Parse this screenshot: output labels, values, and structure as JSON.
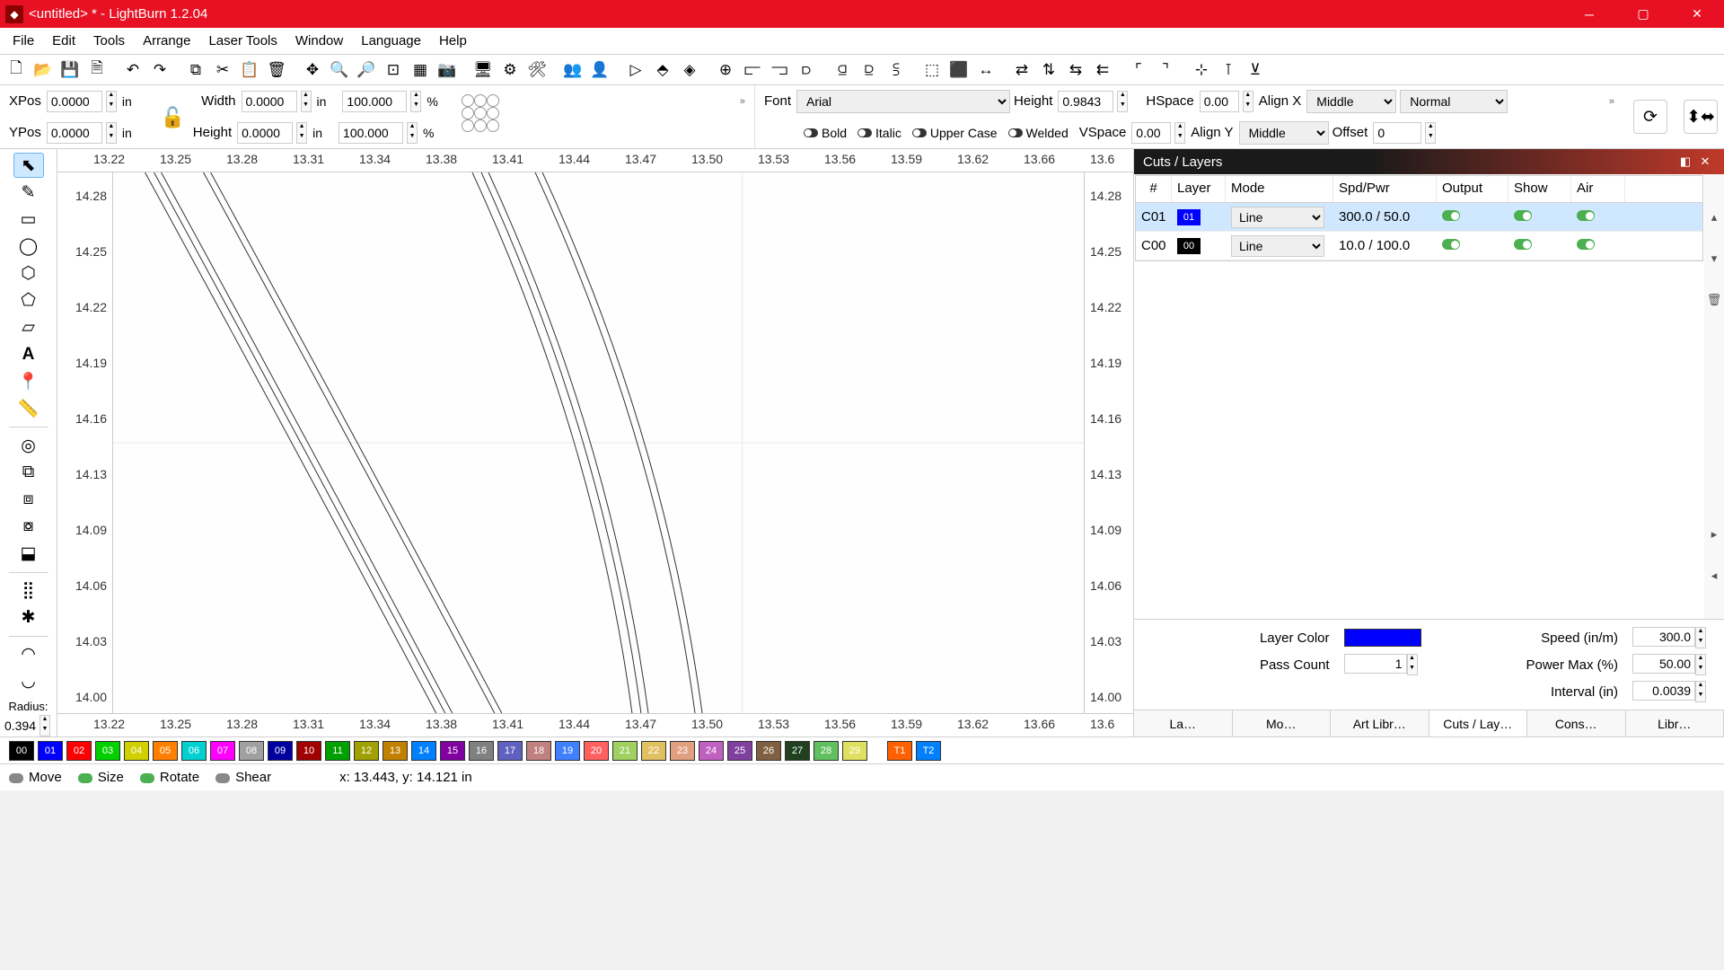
{
  "titlebar": {
    "title": "<untitled> * - LightBurn 1.2.04"
  },
  "menu": [
    "File",
    "Edit",
    "Tools",
    "Arrange",
    "Laser Tools",
    "Window",
    "Language",
    "Help"
  ],
  "props": {
    "xpos_label": "XPos",
    "xpos": "0.0000",
    "xpos_unit": "in",
    "ypos_label": "YPos",
    "ypos": "0.0000",
    "ypos_unit": "in",
    "width_label": "Width",
    "width": "0.0000",
    "width_unit": "in",
    "height_label": "Height",
    "height": "0.0000",
    "height_unit": "in",
    "scale_x": "100.000",
    "scale_x_unit": "%",
    "scale_y": "100.000",
    "scale_y_unit": "%"
  },
  "text_props": {
    "font_label": "Font",
    "font": "Arial",
    "tx_height_label": "Height",
    "tx_height": "0.9843",
    "hspace_label": "HSpace",
    "hspace": "0.00",
    "vspace_label": "VSpace",
    "vspace": "0.00",
    "align_x_label": "Align X",
    "align_x": "Middle",
    "align_y_label": "Align Y",
    "align_y": "Middle",
    "normal": "Normal",
    "offset_label": "Offset",
    "offset": "0",
    "bold": "Bold",
    "italic": "Italic",
    "upper": "Upper Case",
    "welded": "Welded"
  },
  "radius": {
    "label": "Radius:",
    "value": "0.394"
  },
  "ruler_h": [
    "13.22",
    "13.25",
    "13.28",
    "13.31",
    "13.34",
    "13.38",
    "13.41",
    "13.44",
    "13.47",
    "13.50",
    "13.53",
    "13.56",
    "13.59",
    "13.62",
    "13.66",
    "13.6"
  ],
  "ruler_v": [
    "14.28",
    "14.25",
    "14.22",
    "14.19",
    "14.16",
    "14.13",
    "14.09",
    "14.06",
    "14.03",
    "14.00"
  ],
  "cuts": {
    "title": "Cuts / Layers",
    "cols": [
      "#",
      "Layer",
      "Mode",
      "Spd/Pwr",
      "Output",
      "Show",
      "Air"
    ],
    "rows": [
      {
        "id": "C01",
        "badge": "01",
        "badge_bg": "#0000ff",
        "mode": "Line",
        "spd": "300.0 / 50.0"
      },
      {
        "id": "C00",
        "badge": "00",
        "badge_bg": "#000000",
        "mode": "Line",
        "spd": "10.0 / 100.0"
      }
    ],
    "layer_color_label": "Layer Color",
    "speed_label": "Speed (in/m)",
    "speed": "300.0",
    "pass_label": "Pass Count",
    "pass": "1",
    "power_label": "Power Max (%)",
    "power": "50.00",
    "interval_label": "Interval (in)",
    "interval": "0.0039",
    "tabs": [
      "La…",
      "Mo…",
      "Art Libr…",
      "Cuts / Lay…",
      "Cons…",
      "Libr…"
    ]
  },
  "palette": [
    {
      "n": "00",
      "bg": "#000000"
    },
    {
      "n": "01",
      "bg": "#0000ff"
    },
    {
      "n": "02",
      "bg": "#ff0000"
    },
    {
      "n": "03",
      "bg": "#00d000"
    },
    {
      "n": "04",
      "bg": "#d0d000"
    },
    {
      "n": "05",
      "bg": "#ff8000"
    },
    {
      "n": "06",
      "bg": "#00d0d0"
    },
    {
      "n": "07",
      "bg": "#ff00ff"
    },
    {
      "n": "08",
      "bg": "#a0a0a0"
    },
    {
      "n": "09",
      "bg": "#0000a0"
    },
    {
      "n": "10",
      "bg": "#a00000"
    },
    {
      "n": "11",
      "bg": "#00a000"
    },
    {
      "n": "12",
      "bg": "#a0a000"
    },
    {
      "n": "13",
      "bg": "#c08000"
    },
    {
      "n": "14",
      "bg": "#0080ff"
    },
    {
      "n": "15",
      "bg": "#8000a0"
    },
    {
      "n": "16",
      "bg": "#808080"
    },
    {
      "n": "17",
      "bg": "#6060c0"
    },
    {
      "n": "18",
      "bg": "#c08080"
    },
    {
      "n": "19",
      "bg": "#4080ff"
    },
    {
      "n": "20",
      "bg": "#ff6060"
    },
    {
      "n": "21",
      "bg": "#a0d060"
    },
    {
      "n": "22",
      "bg": "#e0c060"
    },
    {
      "n": "23",
      "bg": "#e0a080"
    },
    {
      "n": "24",
      "bg": "#c060c0"
    },
    {
      "n": "25",
      "bg": "#8040a0"
    },
    {
      "n": "26",
      "bg": "#806040"
    },
    {
      "n": "27",
      "bg": "#204020"
    },
    {
      "n": "28",
      "bg": "#60c060"
    },
    {
      "n": "29",
      "bg": "#e0e060"
    }
  ],
  "palette_extra": [
    {
      "n": "T1",
      "bg": "#ff6000"
    },
    {
      "n": "T2",
      "bg": "#0080ff"
    }
  ],
  "status": {
    "move": "Move",
    "size": "Size",
    "rotate": "Rotate",
    "shear": "Shear",
    "coords": "x: 13.443, y: 14.121 in"
  }
}
